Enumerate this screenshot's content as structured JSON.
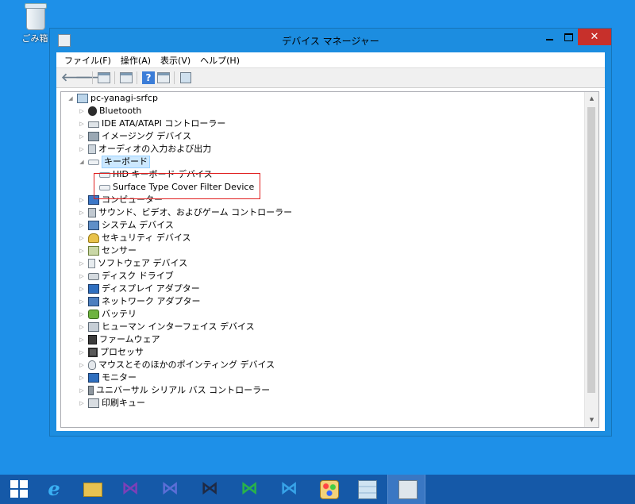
{
  "desktop": {
    "recycle_bin_label": "ごみ箱"
  },
  "window": {
    "title": "デバイス マネージャー",
    "buttons": {
      "minimize": "",
      "maximize": "",
      "close": "✕"
    }
  },
  "menu": [
    {
      "label": "ファイル(F)"
    },
    {
      "label": "操作(A)"
    },
    {
      "label": "表示(V)"
    },
    {
      "label": "ヘルプ(H)"
    }
  ],
  "toolbar": {
    "back": "🡐",
    "forward": "🡒",
    "help": "?"
  },
  "tree": {
    "root": "pc-yanagi-srfcp",
    "categories": [
      {
        "label": "Bluetooth",
        "icon": "bluetooth-icon"
      },
      {
        "label": "IDE ATA/ATAPI コントローラー",
        "icon": "ide-controller-icon"
      },
      {
        "label": "イメージング デバイス",
        "icon": "imaging-device-icon"
      },
      {
        "label": "オーディオの入力および出力",
        "icon": "audio-io-icon"
      },
      {
        "label": "キーボード",
        "icon": "keyboard-icon",
        "expanded": true,
        "children": [
          {
            "label": "HID キーボード デバイス"
          },
          {
            "label": "Surface Type Cover Filter Device"
          }
        ]
      },
      {
        "label": "コンピューター",
        "icon": "computer-icon"
      },
      {
        "label": "サウンド、ビデオ、およびゲーム コントローラー",
        "icon": "sound-controller-icon"
      },
      {
        "label": "システム デバイス",
        "icon": "system-device-icon"
      },
      {
        "label": "セキュリティ デバイス",
        "icon": "security-device-icon"
      },
      {
        "label": "センサー",
        "icon": "sensor-icon"
      },
      {
        "label": "ソフトウェア デバイス",
        "icon": "software-device-icon"
      },
      {
        "label": "ディスク ドライブ",
        "icon": "disk-drive-icon"
      },
      {
        "label": "ディスプレイ アダプター",
        "icon": "display-adapter-icon"
      },
      {
        "label": "ネットワーク アダプター",
        "icon": "network-adapter-icon"
      },
      {
        "label": "バッテリ",
        "icon": "battery-icon"
      },
      {
        "label": "ヒューマン インターフェイス デバイス",
        "icon": "hid-icon"
      },
      {
        "label": "ファームウェア",
        "icon": "firmware-icon"
      },
      {
        "label": "プロセッサ",
        "icon": "processor-icon"
      },
      {
        "label": "マウスとそのほかのポインティング デバイス",
        "icon": "mouse-icon"
      },
      {
        "label": "モニター",
        "icon": "monitor-icon"
      },
      {
        "label": "ユニバーサル シリアル バス コントローラー",
        "icon": "usb-controller-icon"
      },
      {
        "label": "印刷キュー",
        "icon": "print-queue-icon"
      }
    ]
  },
  "colors": {
    "desktop": "#1e90e8",
    "window_frame": "#1c8de0",
    "close_button": "#c7302b",
    "highlight_box": "#e02020",
    "taskbar": "#1559a8"
  }
}
